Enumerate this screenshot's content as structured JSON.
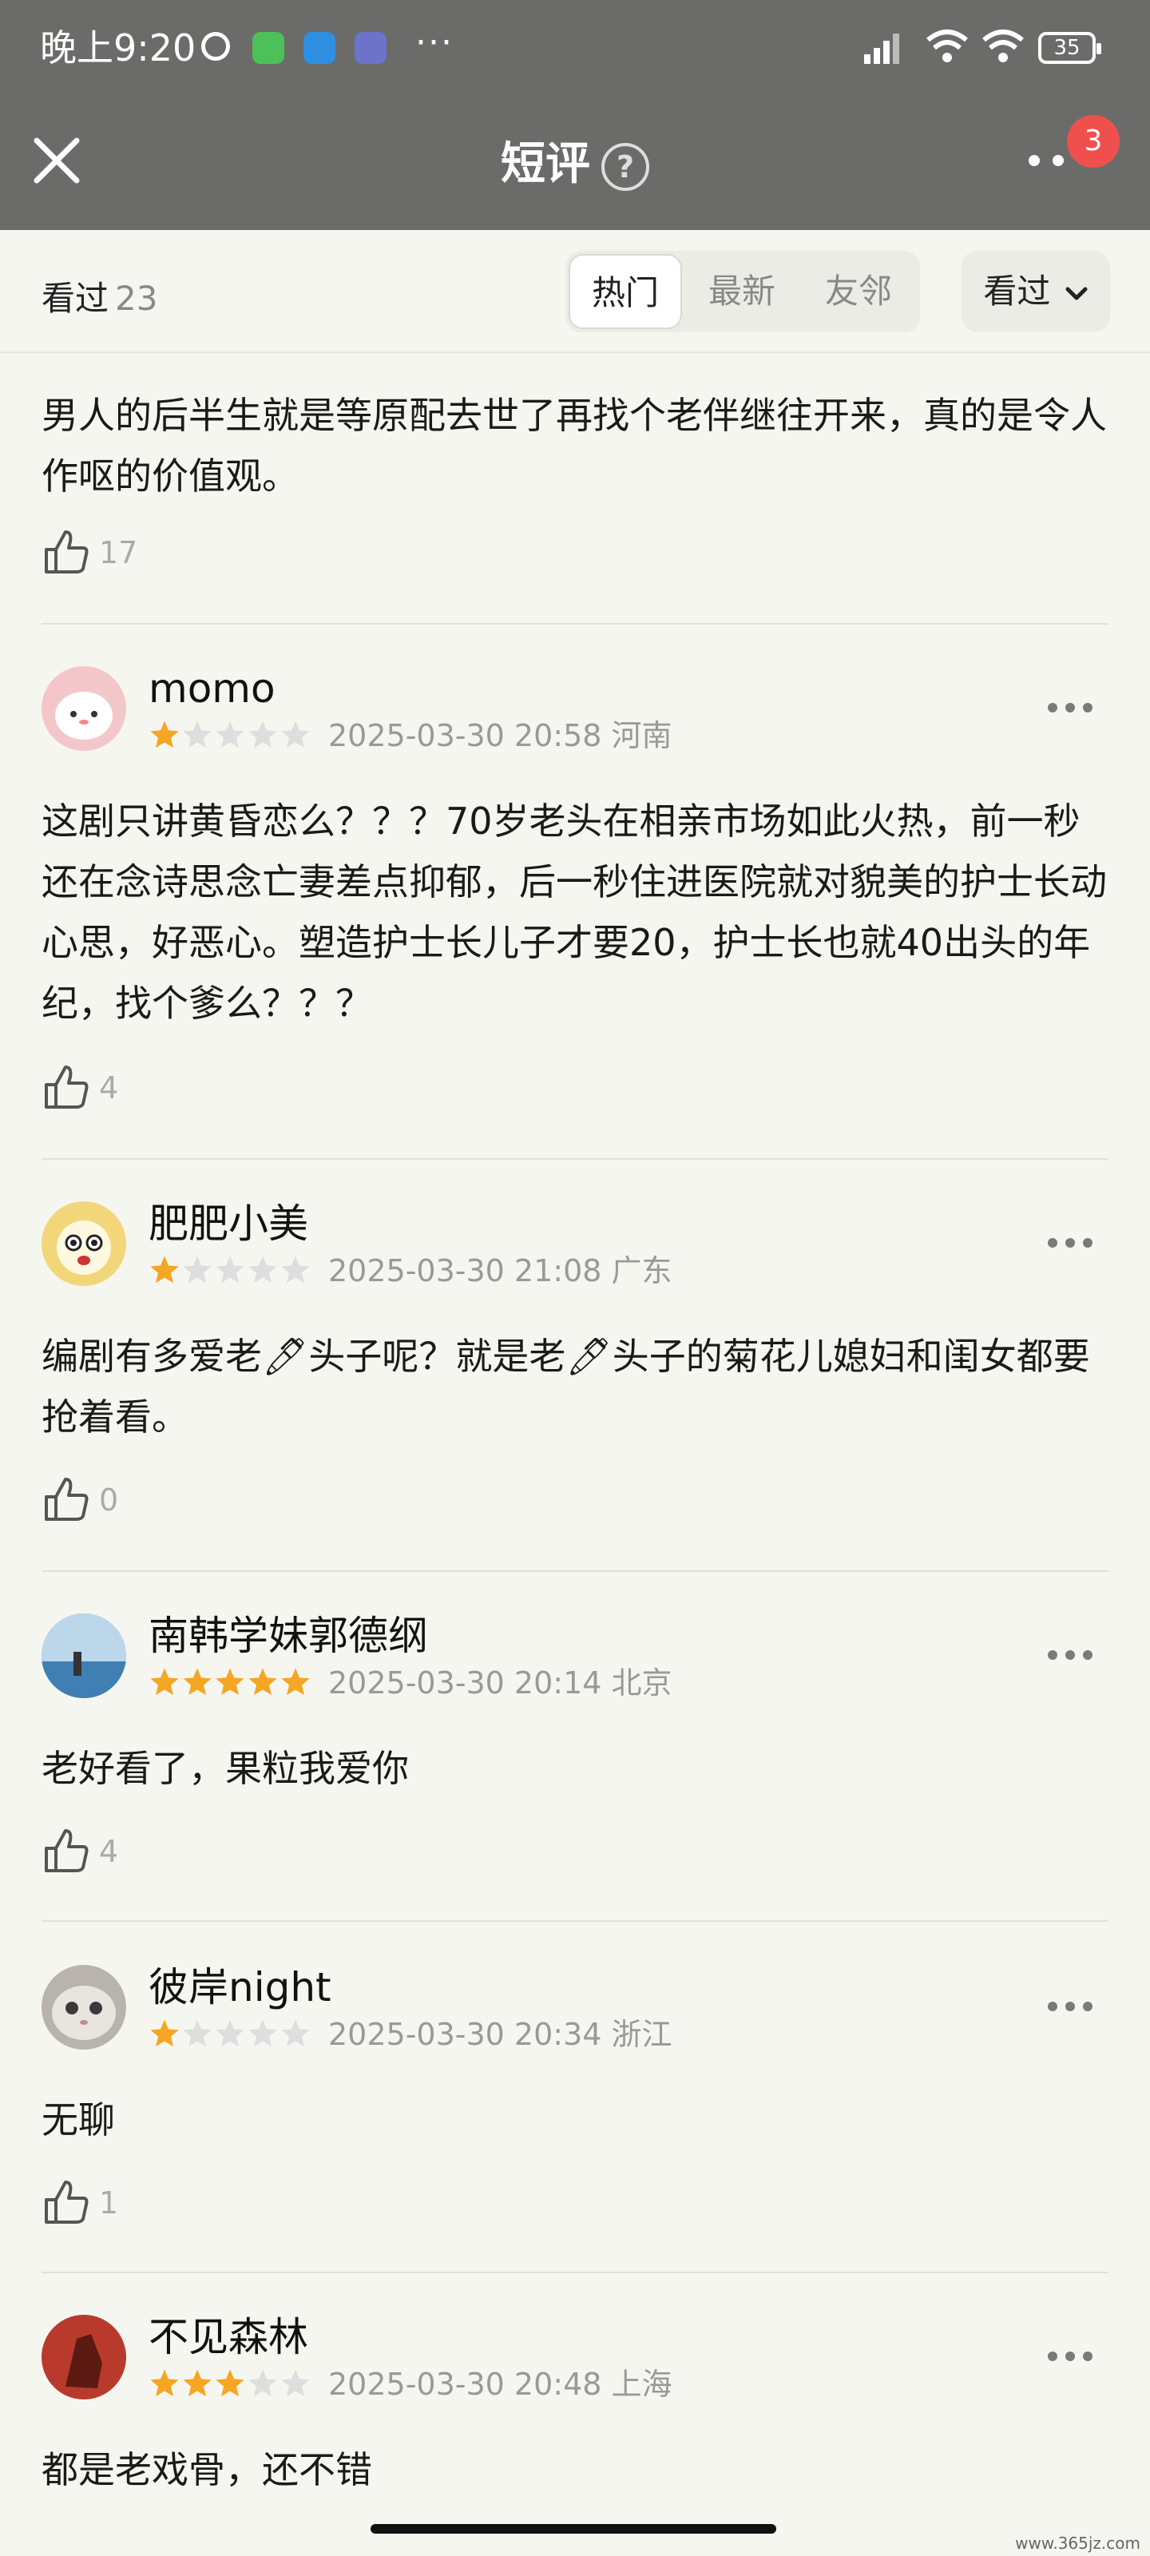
{
  "status_bar": {
    "time": "晚上9:20",
    "battery": "35"
  },
  "header": {
    "title": "短评",
    "help": "?",
    "badge": "3"
  },
  "filter": {
    "seen_label": "看过",
    "seen_count": "23",
    "tabs": [
      "热门",
      "最新",
      "友邻"
    ],
    "active_tab": "热门",
    "dropdown_label": "看过"
  },
  "reviews": [
    {
      "content": "男人的后半生就是等原配去世了再找个老伴继往开来，真的是令人作呕的价值观。",
      "likes": "17"
    },
    {
      "user": "momo",
      "rating": 1,
      "date": "2025-03-30 20:58",
      "location": "河南",
      "content": "这剧只讲黄昏恋么？？？70岁老头在相亲市场如此火热，前一秒还在念诗思念亡妻差点抑郁，后一秒住进医院就对貌美的护士长动心思，好恶心。塑造护士长儿子才要20，护士长也就40出头的年纪，找个爹么？？？",
      "likes": "4"
    },
    {
      "user": "肥肥小美",
      "rating": 1,
      "date": "2025-03-30 21:08",
      "location": "广东",
      "content": "编剧有多爱老🖊头子呢？就是老🖊头子的菊花儿媳妇和闺女都要抢着看。",
      "likes": "0"
    },
    {
      "user": "南韩学妹郭德纲",
      "rating": 5,
      "date": "2025-03-30 20:14",
      "location": "北京",
      "content": "老好看了，果粒我爱你",
      "likes": "4"
    },
    {
      "user": "彼岸night",
      "rating": 1,
      "date": "2025-03-30 20:34",
      "location": "浙江",
      "content": "无聊",
      "likes": "1"
    },
    {
      "user": "不见森林",
      "rating": 3,
      "date": "2025-03-30 20:48",
      "location": "上海",
      "content": "都是老戏骨，还不错"
    }
  ],
  "watermark": "www.365jz.com",
  "colors": {
    "star_on": "#f5a623",
    "star_off": "#dedede",
    "badge": "#f0504d",
    "header_bg": "#6b6c69"
  }
}
